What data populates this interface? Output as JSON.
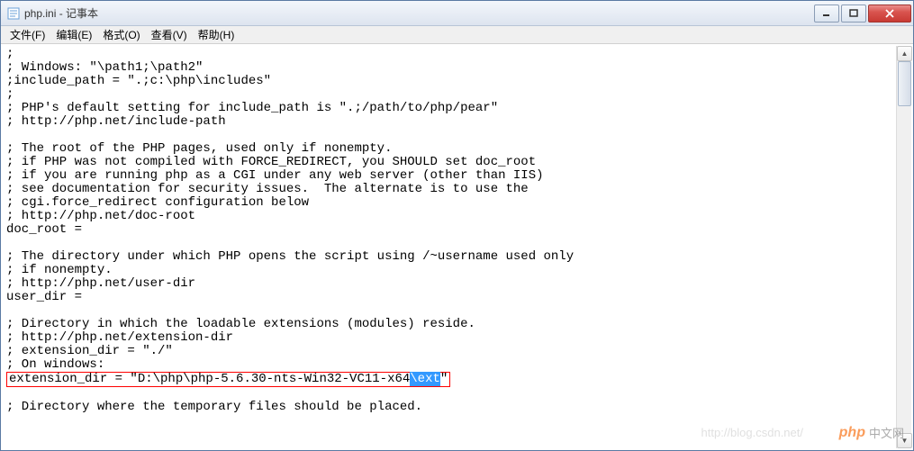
{
  "window": {
    "title": "php.ini - 记事本"
  },
  "menu": {
    "file": "文件(F)",
    "edit": "编辑(E)",
    "format": "格式(O)",
    "view": "查看(V)",
    "help": "帮助(H)"
  },
  "editor": {
    "lines": [
      ";",
      "; Windows: \"\\path1;\\path2\"",
      ";include_path = \".;c:\\php\\includes\"",
      ";",
      "; PHP's default setting for include_path is \".;/path/to/php/pear\"",
      "; http://php.net/include-path",
      "",
      "; The root of the PHP pages, used only if nonempty.",
      "; if PHP was not compiled with FORCE_REDIRECT, you SHOULD set doc_root",
      "; if you are running php as a CGI under any web server (other than IIS)",
      "; see documentation for security issues.  The alternate is to use the",
      "; cgi.force_redirect configuration below",
      "; http://php.net/doc-root",
      "doc_root =",
      "",
      "; The directory under which PHP opens the script using /~username used only",
      "; if nonempty.",
      "; http://php.net/user-dir",
      "user_dir =",
      "",
      "; Directory in which the loadable extensions (modules) reside.",
      "; http://php.net/extension-dir",
      "; extension_dir = \"./\"",
      "; On windows:"
    ],
    "highlighted": {
      "prefix": "extension_dir = \"D:\\php\\php-5.6.30-nts-Win32-VC11-x64",
      "selected": "\\ext",
      "suffix": "\""
    },
    "after": [
      "",
      "; Directory where the temporary files should be placed."
    ]
  },
  "watermark": {
    "url": "http://blog.csdn.net/",
    "brand_prefix": "php",
    "brand_suffix": "中文网"
  }
}
